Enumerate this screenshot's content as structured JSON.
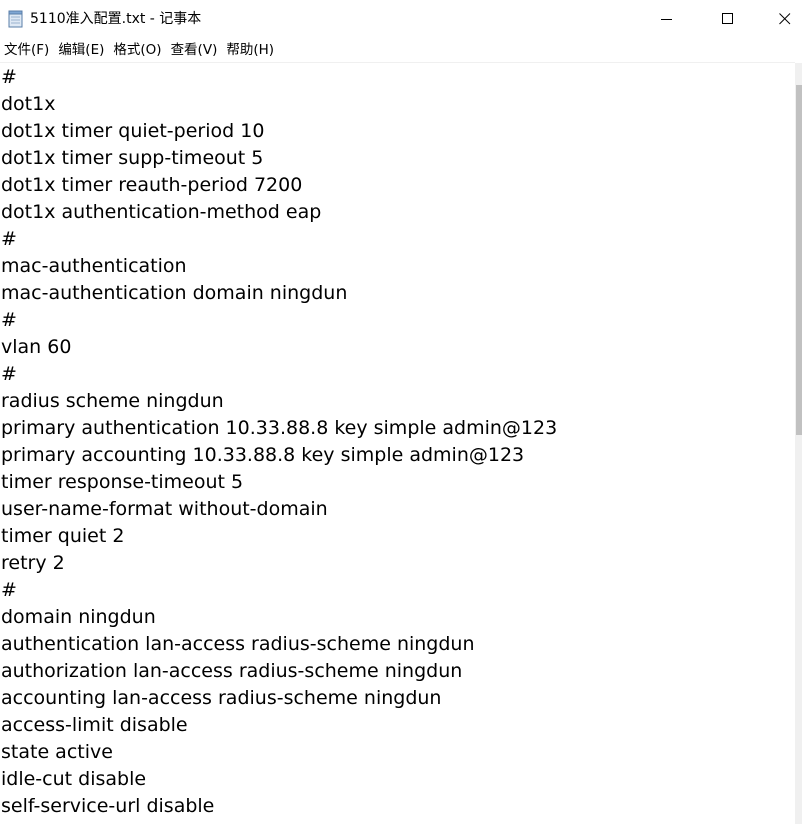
{
  "window": {
    "title": "5110准入配置.txt - 记事本"
  },
  "menu": [
    {
      "label": "文件(F)"
    },
    {
      "label": "编辑(E)"
    },
    {
      "label": "格式(O)"
    },
    {
      "label": "查看(V)"
    },
    {
      "label": "帮助(H)"
    }
  ],
  "editor": {
    "lines": [
      "#",
      "dot1x",
      "dot1x timer quiet-period 10",
      "dot1x timer supp-timeout 5",
      "dot1x timer reauth-period 7200",
      "dot1x authentication-method eap",
      "#",
      "mac-authentication",
      "mac-authentication domain ningdun",
      "#",
      "vlan 60",
      "#",
      "radius scheme ningdun",
      "primary authentication 10.33.88.8 key simple admin@123",
      "primary accounting 10.33.88.8 key simple admin@123",
      "timer response-timeout 5",
      "user-name-format without-domain",
      "timer quiet 2",
      "retry 2",
      "#",
      "domain ningdun",
      "authentication lan-access radius-scheme ningdun",
      "authorization lan-access radius-scheme ningdun",
      "accounting lan-access radius-scheme ningdun",
      "access-limit disable",
      "state active",
      "idle-cut disable",
      "self-service-url disable"
    ]
  },
  "icons": {
    "app": "notepad-icon",
    "minimize": "minimize-icon",
    "maximize": "maximize-icon",
    "close": "close-icon"
  }
}
